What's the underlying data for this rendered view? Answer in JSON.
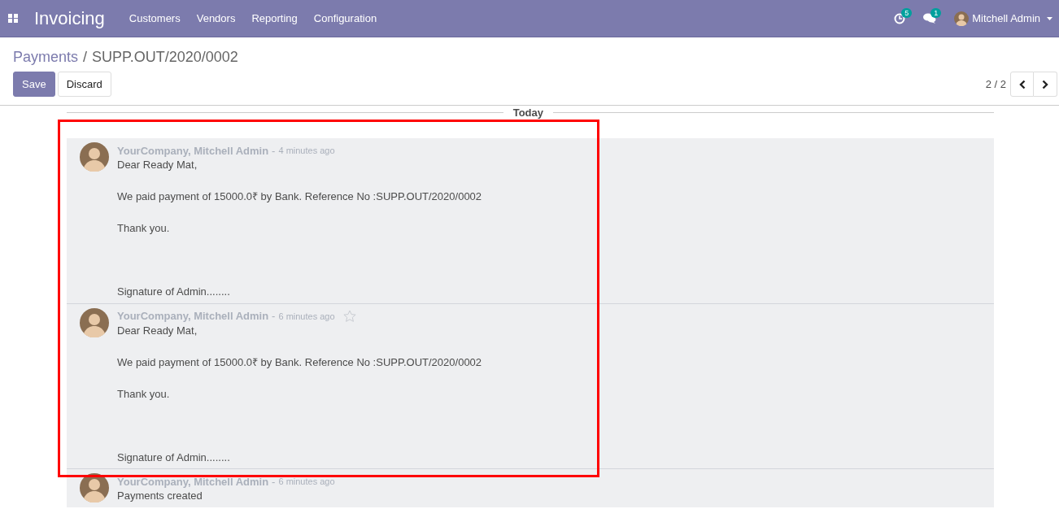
{
  "navbar": {
    "app_title": "Invoicing",
    "menu": [
      "Customers",
      "Vendors",
      "Reporting",
      "Configuration"
    ],
    "activity_count": "5",
    "message_count": "1",
    "user_name": "Mitchell Admin"
  },
  "breadcrumb": {
    "parent": "Payments",
    "separator": "/",
    "current": "SUPP.OUT/2020/0002"
  },
  "buttons": [
    {
      "label": "Save",
      "kind": "primary"
    },
    {
      "label": "Discard",
      "kind": "secondary"
    }
  ],
  "pager": {
    "value": "2 / 2"
  },
  "chatter": {
    "date_separator": "Today",
    "messages": [
      {
        "author": "YourCompany, Mitchell Admin",
        "separator": "-",
        "time": "4 minutes ago",
        "body": [
          {
            "text": "Dear Ready Mat,",
            "kind": "text"
          },
          {
            "text": "We paid payment of 15000.0₹ by Bank. Reference No :SUPP.OUT/2020/0002",
            "kind": "text"
          },
          {
            "text": "Thank you.",
            "kind": "text"
          },
          {
            "text": "Signature of Admin........",
            "kind": "signature"
          }
        ]
      },
      {
        "author": "YourCompany, Mitchell Admin",
        "separator": "-",
        "time": "6 minutes ago",
        "star": {
          "starred": false
        },
        "body": [
          {
            "text": "Dear Ready Mat,",
            "kind": "text"
          },
          {
            "text": "We paid payment of 15000.0₹ by Bank. Reference No :SUPP.OUT/2020/0002",
            "kind": "text"
          },
          {
            "text": "Thank you.",
            "kind": "text"
          },
          {
            "text": "Signature of Admin........",
            "kind": "signature"
          }
        ]
      },
      {
        "author": "YourCompany, Mitchell Admin",
        "separator": "-",
        "time": "6 minutes ago",
        "body": [
          {
            "text": "Payments created",
            "kind": "text"
          }
        ]
      }
    ]
  },
  "annotation": {
    "kind": "highlight-frame",
    "color": "#ff0000"
  }
}
